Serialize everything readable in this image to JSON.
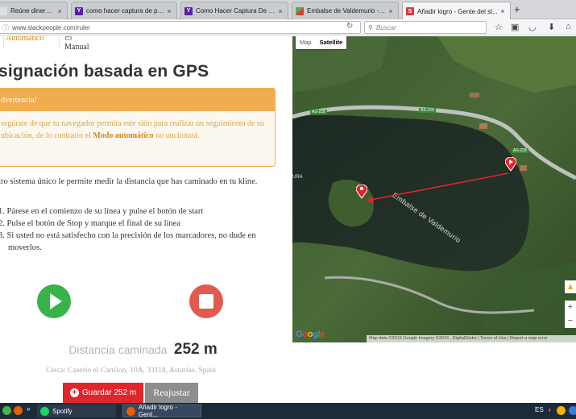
{
  "browser": {
    "tabs": [
      {
        "label": "Reúne dinero par...",
        "favicon": "blank-favicon",
        "active": false
      },
      {
        "label": "como hacer captura de pa...",
        "favicon": "yahoo-favicon",
        "active": false
      },
      {
        "label": "Como Hacer Captura De P...",
        "favicon": "yahoo-favicon",
        "active": false
      },
      {
        "label": "Embalse de Valdemurio - G...",
        "favicon": "maps-favicon",
        "active": false
      },
      {
        "label": "Añadir logro - Gente del sl...",
        "favicon": "slack-favicon",
        "active": true
      }
    ],
    "new_tab_label": "+",
    "url": "www.slackpeople.com/ruler",
    "search_placeholder": "Buscar",
    "close_glyph": "×"
  },
  "page": {
    "mode_tabs": {
      "auto": "Automático",
      "manual": "Manual"
    },
    "title": "signación basada en GPS",
    "warning": {
      "heading": "dvertencia!",
      "text_before": "segúrate de que tu navegador permita este sitio para realizar un seguimiento de su ubicación, de lo contrario el ",
      "bold": "Modo automático",
      "text_after": " no uncionará."
    },
    "intro": "stro sistema único le permite medir la distancia que has caminado en tu kline.",
    "steps": [
      "1. Párese en el comienzo de su línea y pulse el botón de start",
      "2. Pulse el botón de Stop y marque el final de su línea",
      "3. Si usted no está satisfecho con la precisión de los marcadores, no dude en moverlos."
    ],
    "distance_label": "Distancia caminada",
    "distance_value": "252 m",
    "near": "Cerca: Caserio el Carrilon, 10A, 33118, Asturias, Spain",
    "save_label": "Guardar 252 m",
    "reset_label": "Reajustar"
  },
  "map": {
    "type_map": "Map",
    "type_satellite": "Satellite",
    "lake_label": "Embalse de Valdemurio",
    "road_labels": [
      "AS-229",
      "AS-229",
      "AS-229"
    ],
    "partial_label": "URA",
    "google_logo": "Google",
    "attribution": "Map data ©2016 Google Imagery ©2016 , DigitalGlobe | Terms of Use | Report a map error",
    "zoom_in": "+",
    "zoom_out": "−",
    "line_color": "#e0262c",
    "marker_color": "#e0262c"
  },
  "taskbar": {
    "spotify": "Spotify",
    "browser": "Añadir logro - Gent...",
    "language": "ES"
  },
  "colors": {
    "accent_orange": "#f0ad4e",
    "start_green": "#38b349",
    "stop_red": "#e15a4f",
    "save_red": "#e0262c"
  }
}
